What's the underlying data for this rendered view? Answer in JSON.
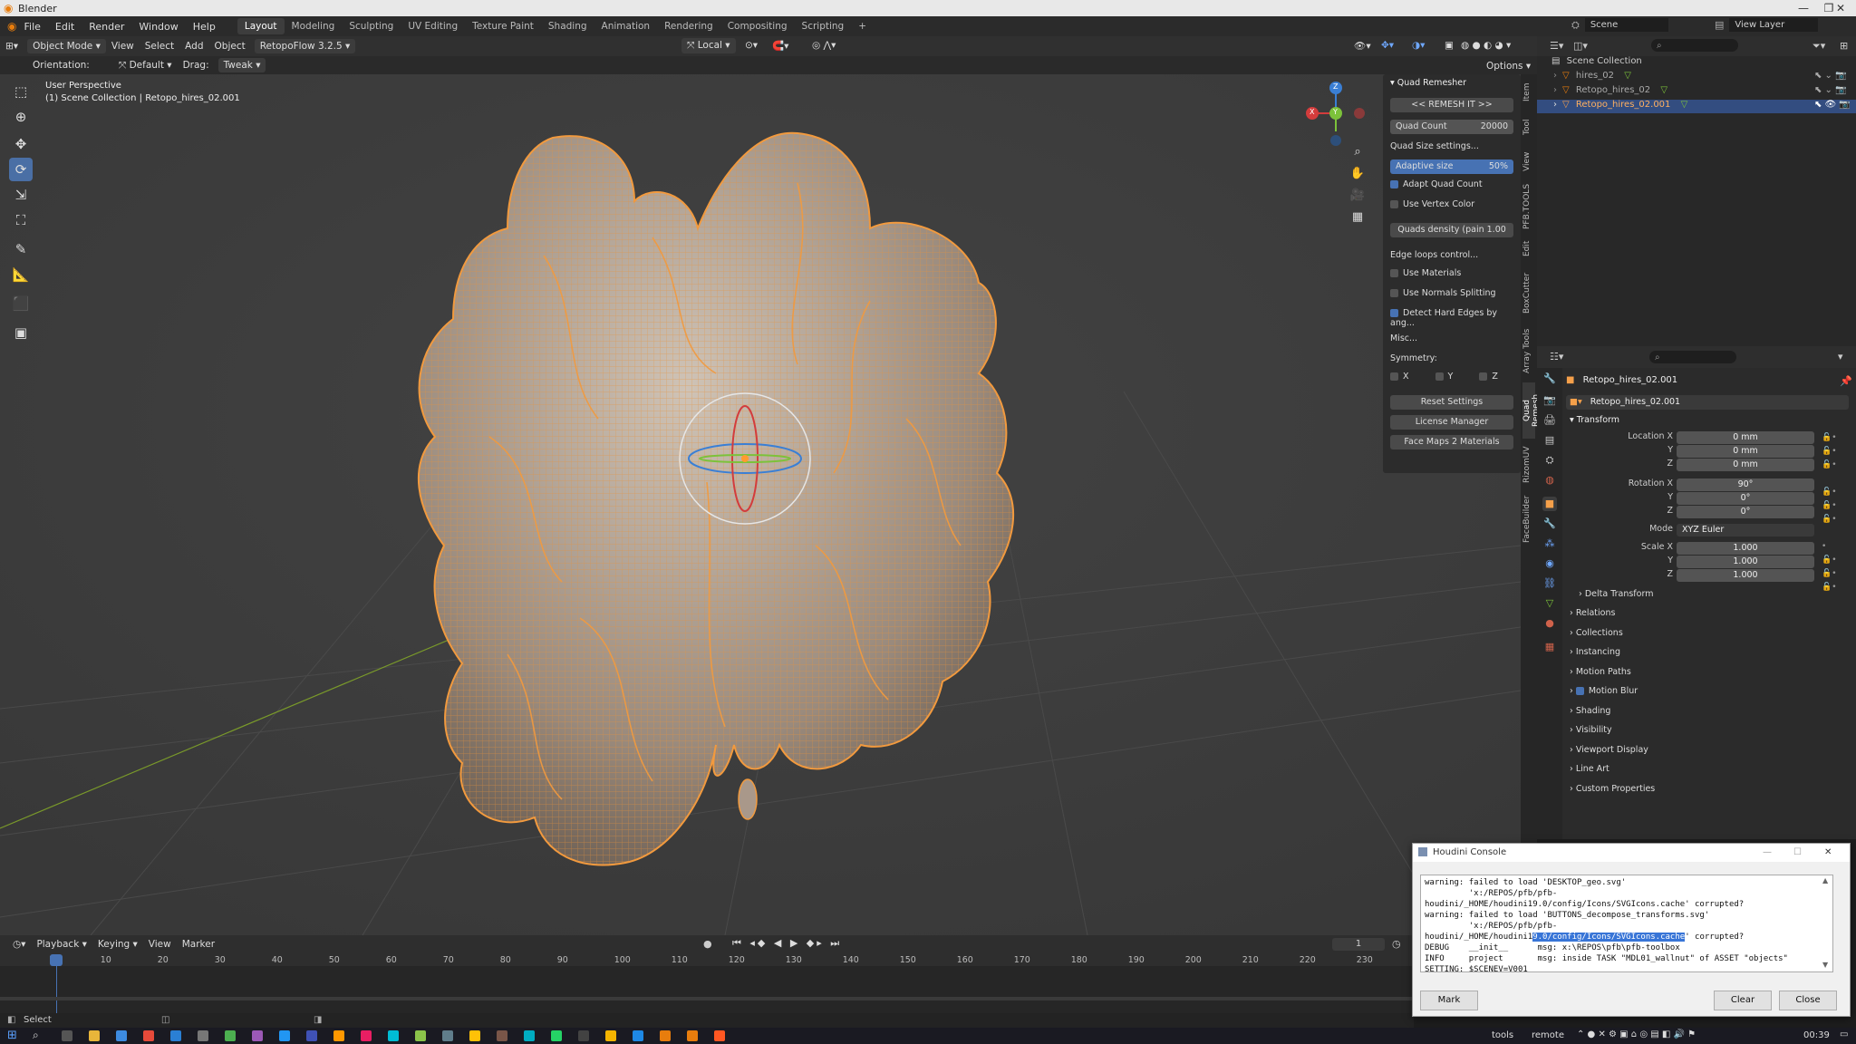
{
  "window": {
    "title": "Blender"
  },
  "menu": {
    "items": [
      "File",
      "Edit",
      "Render",
      "Window",
      "Help"
    ]
  },
  "workspaces": [
    "Layout",
    "Modeling",
    "Sculpting",
    "UV Editing",
    "Texture Paint",
    "Shading",
    "Animation",
    "Rendering",
    "Compositing",
    "Scripting",
    "+"
  ],
  "topright": {
    "scene": "Scene",
    "view_layer": "View Layer"
  },
  "header": {
    "mode": "Object Mode",
    "menus": [
      "View",
      "Select",
      "Add",
      "Object"
    ],
    "addon": "RetopoFlow 3.2.5",
    "transform": "Local",
    "orientation_label": "Orientation:",
    "orientation": "Default",
    "drag_label": "Drag:",
    "drag": "Tweak",
    "options": "Options"
  },
  "viewport": {
    "perspective": "User Perspective",
    "collection_info": "(1) Scene Collection | Retopo_hires_02.001",
    "gizmo": {
      "x": "X",
      "y": "Y",
      "z": "Z"
    }
  },
  "npanel": {
    "title": "Quad Remesher",
    "remesh": "<< REMESH IT >>",
    "quad_count_label": "Quad Count",
    "quad_count_value": "20000",
    "quad_size_settings": "Quad Size settings...",
    "adaptive_label": "Adaptive size",
    "adaptive_value": "50%",
    "adapt_quad_count": "Adapt Quad Count",
    "use_vertex_color": "Use Vertex Color",
    "quads_density": "Quads density (pain 1.00",
    "edge_loops": "Edge loops control...",
    "use_materials": "Use Materials",
    "use_normals": "Use Normals Splitting",
    "detect_hard": "Detect Hard Edges by ang...",
    "misc": "Misc...",
    "symmetry": "Symmetry:",
    "sym_x": "X",
    "sym_y": "Y",
    "sym_z": "Z",
    "reset": "Reset Settings",
    "license": "License Manager",
    "face_maps": "Face Maps 2 Materials"
  },
  "side_tabs": [
    "Item",
    "Tool",
    "View",
    "PFB.TOOLS",
    "Edit",
    "BoxCutter",
    "Array Tools",
    "Quad Remesh",
    "RizomUV",
    "FaceBuilder"
  ],
  "outliner": {
    "root": "Scene Collection",
    "items": [
      "hires_02",
      "Retopo_hires_02",
      "Retopo_hires_02.001"
    ]
  },
  "properties": {
    "object": "Retopo_hires_02.001",
    "object_field": "Retopo_hires_02.001",
    "transform": "Transform",
    "location_label": "Location X",
    "loc": [
      "0 mm",
      "0 mm",
      "0 mm"
    ],
    "rotation_label": "Rotation X",
    "rot": [
      "90°",
      "0°",
      "0°"
    ],
    "mode_label": "Mode",
    "mode": "XYZ Euler",
    "scale_label": "Scale X",
    "scale": [
      "1.000",
      "1.000",
      "1.000"
    ],
    "y": "Y",
    "z": "Z",
    "panels": [
      "Delta Transform",
      "Relations",
      "Collections",
      "Instancing",
      "Motion Paths",
      "Motion Blur",
      "Shading",
      "Visibility",
      "Viewport Display",
      "Line Art",
      "Custom Properties"
    ]
  },
  "timeline": {
    "menus": [
      "Playback",
      "Keying",
      "View",
      "Marker"
    ],
    "current_frame": "1",
    "ticks": [
      "1",
      "10",
      "20",
      "30",
      "40",
      "50",
      "60",
      "70",
      "80",
      "90",
      "100",
      "110",
      "120",
      "130",
      "140",
      "150",
      "160",
      "170",
      "180",
      "190",
      "200",
      "210",
      "220",
      "230"
    ]
  },
  "status": {
    "select": "Select"
  },
  "console": {
    "title": "Houdini Console",
    "lines": [
      "warning: failed to load 'DESKTOP_geo.svg'",
      "         'x:/REPOS/pfb/pfb-",
      "houdini/_HOME/houdini19.0/config/Icons/SVGIcons.cache' corrupted?",
      "warning: failed to load 'BUTTONS_decompose_transforms.svg'",
      "         'x:/REPOS/pfb/pfb-",
      "houdini/_HOME/houdini1",
      "DEBUG    __init__      msg: x:\\REPOS\\pfb\\pfb-toolbox",
      "INFO     project       msg: inside TASK \"MDL01_wallnut\" of ASSET \"objects\"",
      "SETTING: $SCENEV=V001"
    ],
    "highlight": "9.0/config/Icons/SVGIcons.cache",
    "highlight_after": "' corrupted?",
    "mark": "Mark",
    "clear": "Clear",
    "close": "Close"
  },
  "taskbar": {
    "tools": "tools",
    "remote": "remote",
    "time": "00:39"
  }
}
